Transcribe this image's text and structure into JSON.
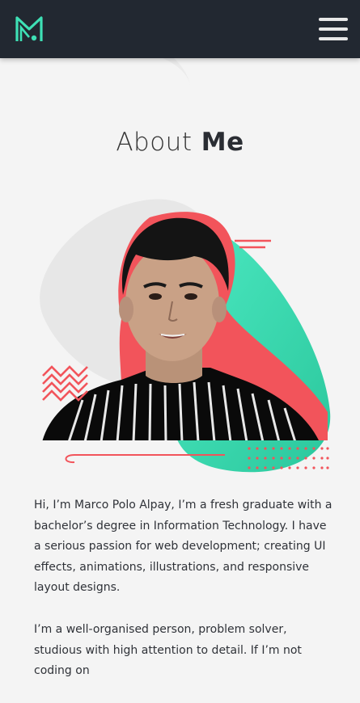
{
  "header": {
    "logo_icon": "m-monogram-logo-icon",
    "menu_icon": "hamburger-menu-icon",
    "background_color": "#222831",
    "accent_color": "#3ee0b5"
  },
  "about": {
    "title_light": "About",
    "title_bold": "Me",
    "portrait_alt": "Portrait of Marco Polo Alpay",
    "paragraphs": [
      "Hi, I’m Marco Polo Alpay, I’m a fresh graduate with a bachelor’s degree in Information Technology. I have a serious passion for web development; creating UI effects, animations, illustrations, and responsive layout designs.",
      "I’m a well-organised person, problem solver, studious with high attention to detail. If I’m not coding on"
    ]
  },
  "colors": {
    "teal": "#3ee0b5",
    "coral": "#f2545b",
    "gray_blob": "#e6e6e6"
  }
}
